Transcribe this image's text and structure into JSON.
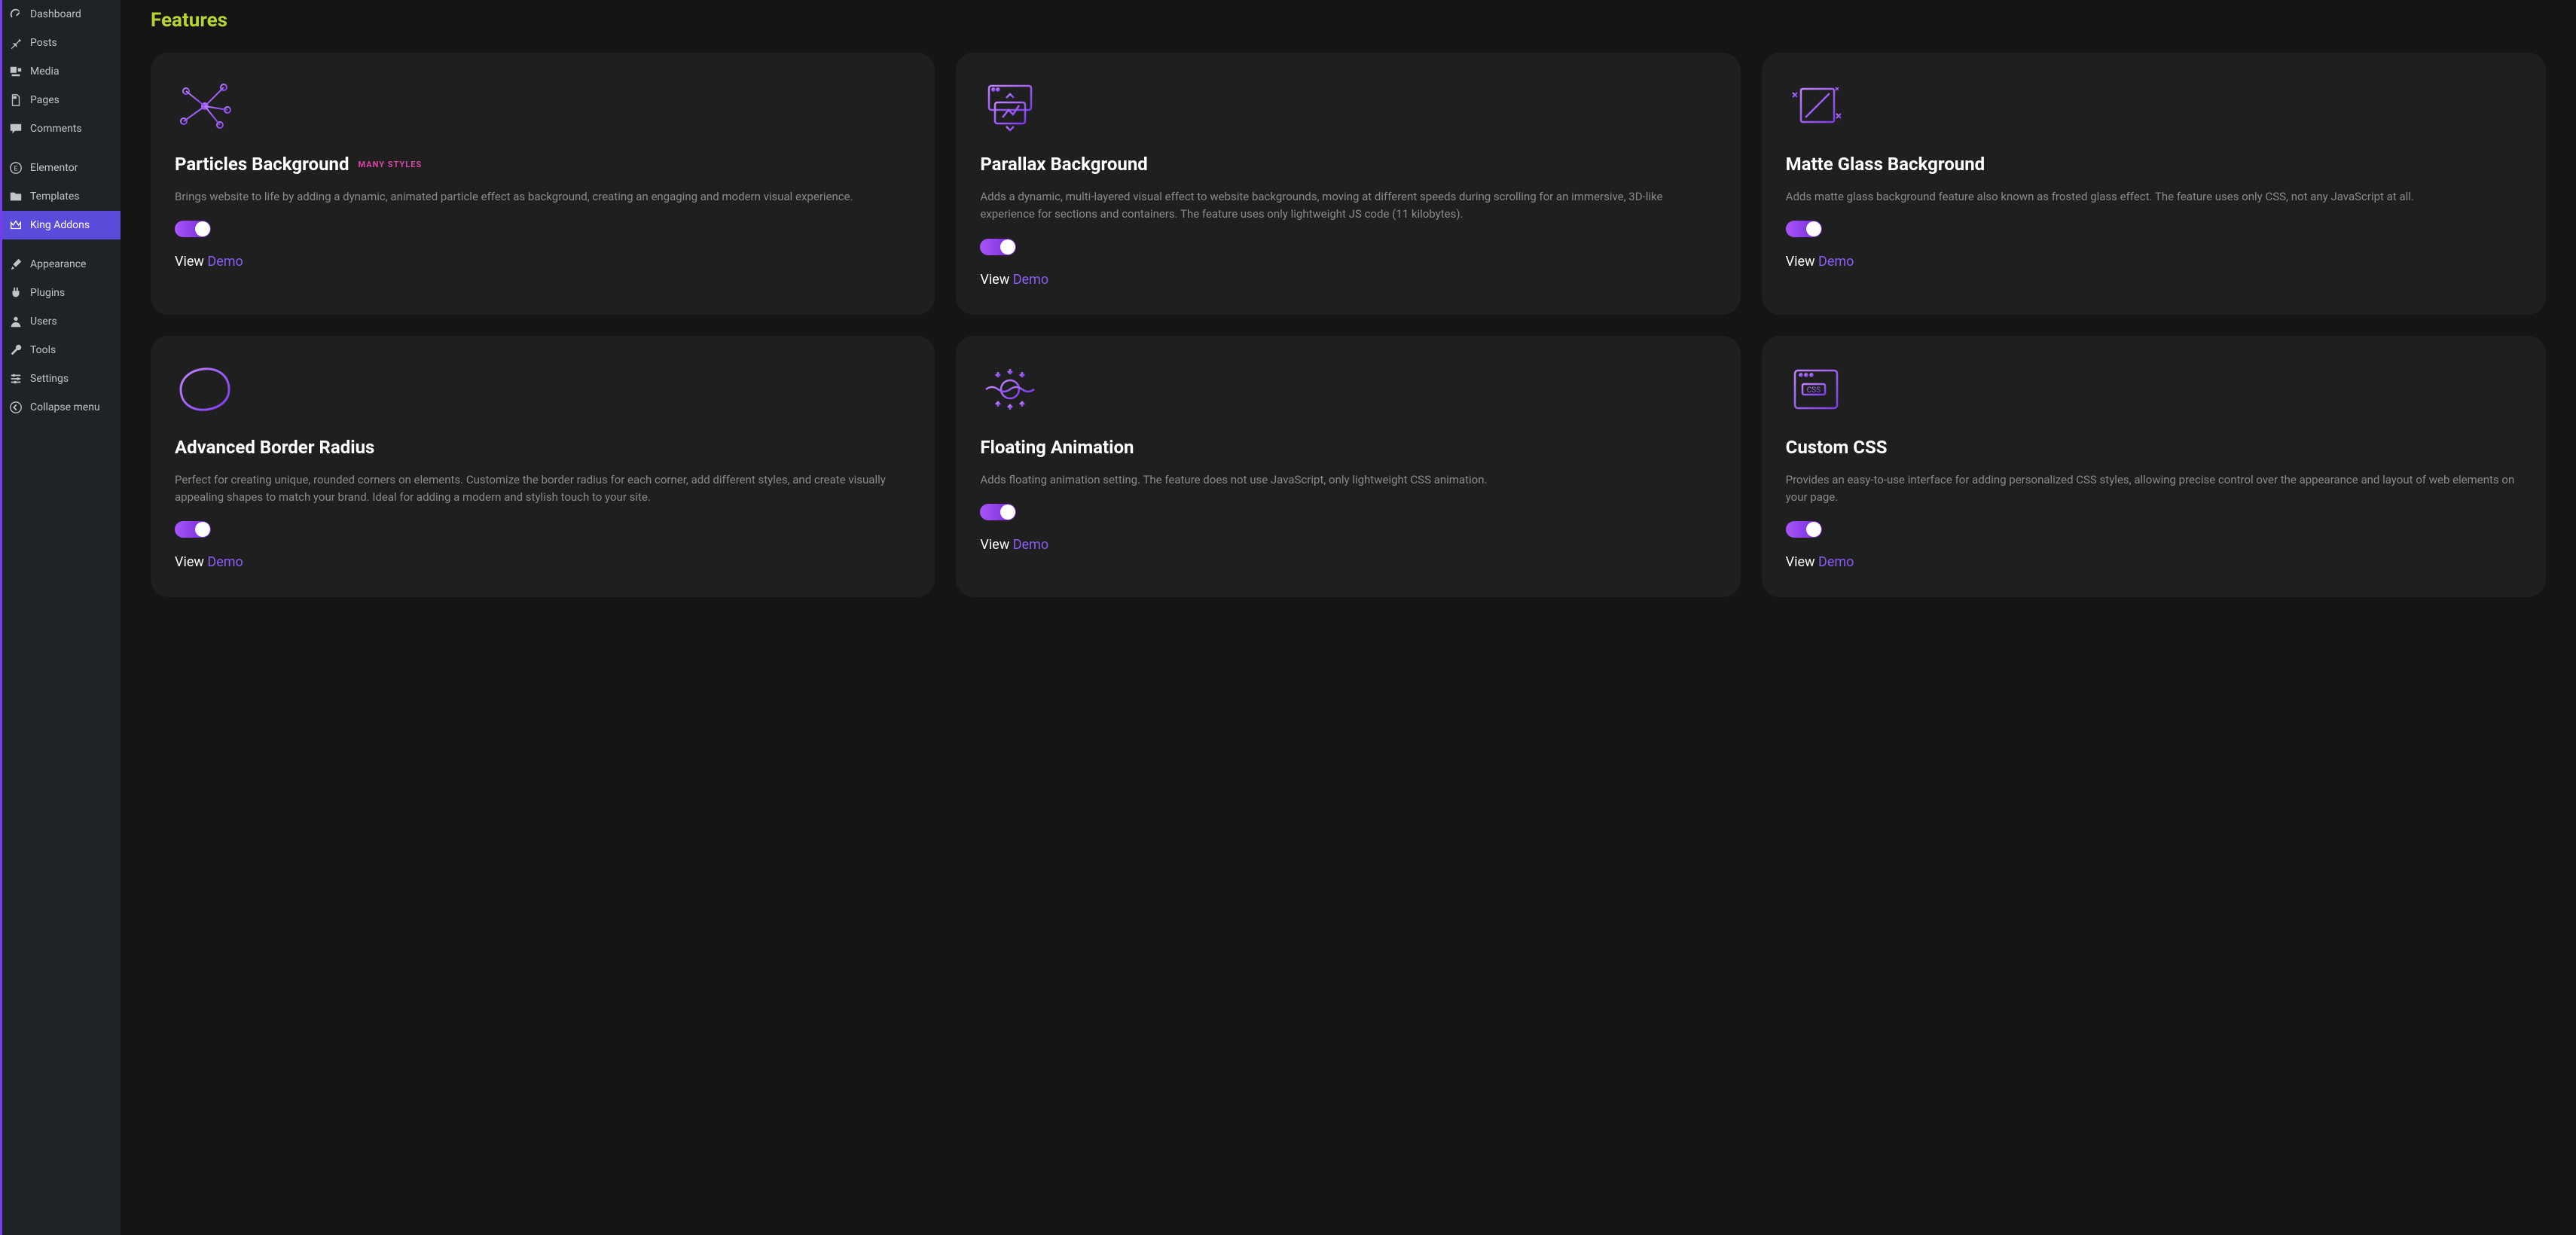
{
  "sidebar": {
    "items": [
      {
        "label": "Dashboard",
        "icon": "gauge"
      },
      {
        "label": "Posts",
        "icon": "pin"
      },
      {
        "label": "Media",
        "icon": "media"
      },
      {
        "label": "Pages",
        "icon": "page"
      },
      {
        "label": "Comments",
        "icon": "comment"
      },
      {
        "label": "Elementor",
        "icon": "circle-e"
      },
      {
        "label": "Templates",
        "icon": "folder"
      },
      {
        "label": "King Addons",
        "icon": "crown",
        "active": true
      },
      {
        "label": "Appearance",
        "icon": "brush"
      },
      {
        "label": "Plugins",
        "icon": "plug"
      },
      {
        "label": "Users",
        "icon": "user"
      },
      {
        "label": "Tools",
        "icon": "wrench"
      },
      {
        "label": "Settings",
        "icon": "sliders"
      },
      {
        "label": "Collapse menu",
        "icon": "collapse"
      }
    ],
    "separators_after": [
      4,
      7
    ]
  },
  "page": {
    "title": "Features"
  },
  "features": [
    {
      "title": "Particles Background",
      "badge": "MANY STYLES",
      "desc": "Brings website to life by adding a dynamic, animated particle effect as background, creating an engaging and modern visual experience.",
      "view": "View",
      "demo": "Demo"
    },
    {
      "title": "Parallax Background",
      "badge": "",
      "desc": "Adds a dynamic, multi-layered visual effect to website backgrounds, moving at different speeds during scrolling for an immersive, 3D-like experience for sections and containers. The feature uses only lightweight JS code (11 kilobytes).",
      "view": "View",
      "demo": "Demo"
    },
    {
      "title": "Matte Glass Background",
      "badge": "",
      "desc": "Adds matte glass background feature also known as frosted glass effect. The feature uses only CSS, not any JavaScript at all.",
      "view": "View",
      "demo": "Demo"
    },
    {
      "title": "Advanced Border Radius",
      "badge": "",
      "desc": "Perfect for creating unique, rounded corners on elements. Customize the border radius for each corner, add different styles, and create visually appealing shapes to match your brand. Ideal for adding a modern and stylish touch to your site.",
      "view": "View",
      "demo": "Demo"
    },
    {
      "title": "Floating Animation",
      "badge": "",
      "desc": "Adds floating animation setting. The feature does not use JavaScript, only lightweight CSS animation.",
      "view": "View",
      "demo": "Demo"
    },
    {
      "title": "Custom CSS",
      "badge": "",
      "desc": "Provides an easy-to-use interface for adding personalized CSS styles, allowing precise control over the appearance and layout of web elements on your page.",
      "view": "View",
      "demo": "Demo"
    }
  ],
  "colors": {
    "accent": "#8b5cf6",
    "title_accent": "#b7d334",
    "badge": "#d946a8"
  }
}
